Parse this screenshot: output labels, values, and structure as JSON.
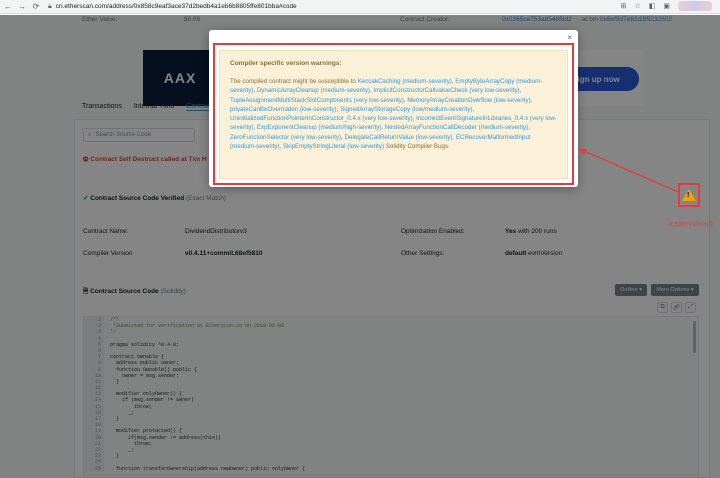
{
  "browser": {
    "url": "cn.etherscan.com/address/0x858c9eaf3ace37d2bedb4a1eb6b8805ffe801bba#code"
  },
  "top_row": {
    "ether_value_label": "Ether Value:",
    "ether_value": "$0.00",
    "creator_label": "Contract Creator:",
    "creator_address": "0x0265ce753a8546f8d2",
    "creator_at": "at txn",
    "creator_txn": "0x8ef9d7e82d3f9232602"
  },
  "banner": {
    "logo_text": "AAX",
    "button_label": "Sign up now"
  },
  "tabs": [
    "Transactions",
    "Internal Txns",
    "Contract"
  ],
  "search": {
    "placeholder": "Search Source Code"
  },
  "self_destruct": "Contract Self Destruct called at Txn H",
  "verified": {
    "title": "Contract Source Code Verified",
    "match": "(Exact Match)"
  },
  "info": {
    "name_label": "Contract Name:",
    "name_value": "DividendDistributorv3",
    "compiler_label": "Compiler Version",
    "compiler_value": "v0.4.11+commit.68ef5810",
    "opt_label": "Optimization Enabled:",
    "opt_value_bold": "Yes",
    "opt_value_rest": "with 200 runs",
    "other_label": "Other Settings:",
    "other_value_bold": "default",
    "other_value_rest": "evmVersion"
  },
  "source": {
    "title": "Contract Source Code",
    "lang": "(Solidity)",
    "outline": "Outline",
    "more": "More Options"
  },
  "code_lines": [
    {
      "n": "1",
      "t": "/**",
      "c": true
    },
    {
      "n": "2",
      "t": " *Submitted for verification at Etherscan.io on 2018-02-08",
      "c": true
    },
    {
      "n": "3",
      "t": "*/",
      "c": true
    },
    {
      "n": "4",
      "t": "",
      "c": false
    },
    {
      "n": "5",
      "t": "pragma solidity ^0.4.0;",
      "c": false
    },
    {
      "n": "6",
      "t": "",
      "c": false
    },
    {
      "n": "7",
      "t": "contract Ownable {",
      "c": false
    },
    {
      "n": "8",
      "t": "  address public owner;",
      "c": false
    },
    {
      "n": "9",
      "t": "  function Ownable() public {",
      "c": false
    },
    {
      "n": "10",
      "t": "    owner = msg.sender;",
      "c": false
    },
    {
      "n": "11",
      "t": "  }",
      "c": false
    },
    {
      "n": "12",
      "t": "",
      "c": false
    },
    {
      "n": "13",
      "t": "  modifier onlyOwner() {",
      "c": false
    },
    {
      "n": "14",
      "t": "    if (msg.sender != owner)",
      "c": false
    },
    {
      "n": "15",
      "t": "        throw;",
      "c": false
    },
    {
      "n": "16",
      "t": "      _;",
      "c": false
    },
    {
      "n": "17",
      "t": "  }",
      "c": false
    },
    {
      "n": "18",
      "t": "",
      "c": false
    },
    {
      "n": "19",
      "t": "  modifier protected() {",
      "c": false
    },
    {
      "n": "20",
      "t": "      if(msg.sender != address(this))",
      "c": false
    },
    {
      "n": "21",
      "t": "        throw;",
      "c": false
    },
    {
      "n": "22",
      "t": "      _;",
      "c": false
    },
    {
      "n": "23",
      "t": "  }",
      "c": false
    },
    {
      "n": "24",
      "t": "",
      "c": false
    },
    {
      "n": "25",
      "t": "  function transferOwnership(address newOwner) public onlyOwner {",
      "c": false
    }
  ],
  "modal": {
    "close": "×",
    "title": "Compiler specific version warnings:",
    "intro": "The compiled contract might be susceptible to",
    "warnings": [
      "KeccakCaching (medium-severity),",
      "EmptyByteArrayCopy (medium-severity),",
      "DynamicArrayCleanup (medium-severity),",
      "ImplicitConstructorCallvalueCheck (very low-severity),",
      "TupleAssignmentMultiStackSlotComponents (very low-severity),",
      "MemoryArrayCreationOverflow (low-severity),",
      "privateCanBeOverridden (low-severity),",
      "SignedArrayStorageCopy (low/medium-severity),",
      "UninitializedFunctionPointerInConstructor_0.4.x (very low-severity),",
      "IncorrectEventSignatureInLibraries_0.4.x (very low-severity),",
      "ExpExponentCleanup (medium/high-severity),",
      "NestedArrayFunctionCallDecoder (medium-severity),",
      "ZeroFunctionSelector (very low-severity),",
      "DelegateCallReturnValue (low-severity),",
      "ECRecoverMalformedInput (medium-severity),",
      "SkipEmptyStringLiteral (low-severity)"
    ],
    "outro": "Solidity Compiler Bugs."
  },
  "annotation": {
    "text": "点击感叹号即可出现",
    "colors": {
      "highlight": "#e23c3c",
      "warning_icon": "#f2a200"
    }
  }
}
